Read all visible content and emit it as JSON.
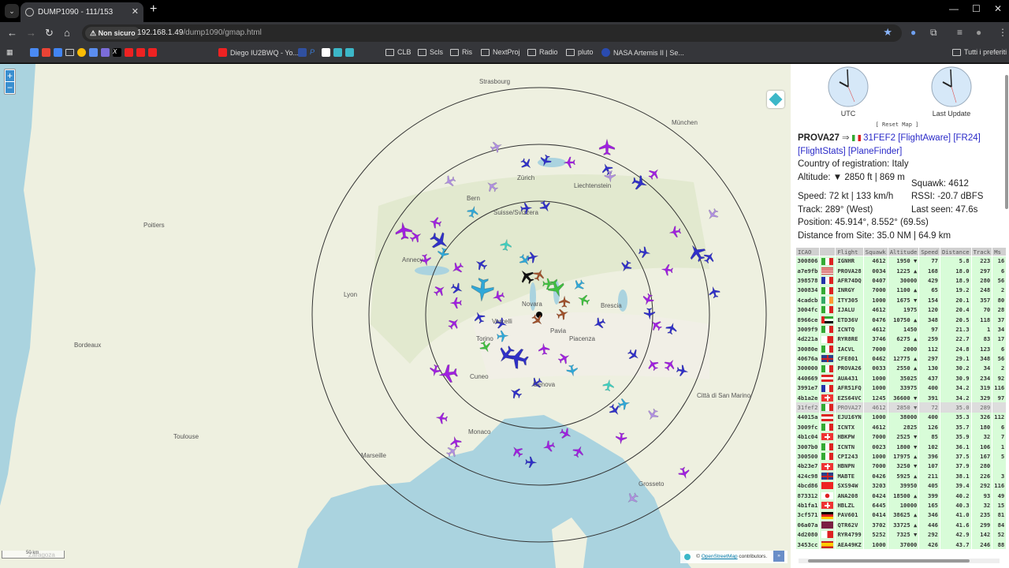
{
  "browser": {
    "tab_title": "DUMP1090 - 111/153",
    "security": "Non sicuro",
    "url_host": "192.168.1.49",
    "url_path": "/dump1090/gmap.html",
    "bookmarks": [
      "Diego IU2BWQ - Yo...",
      "CLB",
      "Scls",
      "Ris",
      "NextProj",
      "Radio",
      "pluto",
      "NASA Artemis II | Se..."
    ],
    "all_bookmarks": "Tutti i preferiti"
  },
  "map": {
    "zoom_in": "+",
    "zoom_out": "−",
    "attribution_prefix": "©",
    "attribution_link": "OpenStreetMap",
    "attribution_suffix": "contributors.",
    "scale": "50 km",
    "cities": [
      "Strasbourg",
      "München",
      "Zürich",
      "Liechtenstein",
      "Bern",
      "Suisse/Svizzera",
      "Poitiers",
      "Lyon",
      "Annecy",
      "Bordeaux",
      "Novara",
      "Vercelli",
      "Pavia",
      "Piacenza",
      "Brescia",
      "Torino",
      "Cuneo",
      "Genova",
      "Monaco",
      "Marseille",
      "Toulouse",
      "Città di San Marino",
      "Grosseto",
      "Zaragoza"
    ]
  },
  "panel": {
    "clock_utc": "UTC",
    "clock_last": "Last Update",
    "reset": "[ Reset Map ]",
    "selected": {
      "flight": "PROVA27",
      "arrow": "⇒",
      "icao": "31FEF2",
      "links": [
        "[FlightAware]",
        "[FR24]",
        "[FlightStats]",
        "[PlaneFinder]"
      ],
      "country": "Country of registration: Italy",
      "altitude": "Altitude: ▼ 2850 ft | 869 m",
      "squawk": "Squawk: 4612",
      "speed": "Speed: 72 kt | 133 km/h",
      "rssi": "RSSI: -20.7 dBFS",
      "track": "Track: 289° (West)",
      "last_seen": "Last seen: 47.6s",
      "position": "Position: 45.914°, 8.552° (69.5s)",
      "distance": "Distance from Site: 35.0 NM | 64.9 km"
    },
    "columns": [
      "ICAO",
      "",
      "Flight",
      "Squawk",
      "Altitude",
      "Speed",
      "Distance",
      "Track",
      "Ms"
    ],
    "rows": [
      [
        "300806",
        "it",
        "IGNHR",
        "4612",
        "1950 ▼",
        "77",
        "5.8",
        "223",
        "16"
      ],
      [
        "a7e9fb",
        "us",
        "PROVA28",
        "0034",
        "1225 ▲",
        "168",
        "18.0",
        "297",
        "6"
      ],
      [
        "398578",
        "fr",
        "AFR74DQ",
        "0407",
        "30000",
        "429",
        "18.9",
        "280",
        "56"
      ],
      [
        "300834",
        "it",
        "INRGY",
        "7000",
        "1100 ▲",
        "65",
        "19.2",
        "248",
        "2"
      ],
      [
        "4cadcb",
        "ie",
        "ITY305",
        "1000",
        "1675 ▼",
        "154",
        "20.1",
        "357",
        "80"
      ],
      [
        "3004fc",
        "it",
        "IJALU",
        "4612",
        "1975",
        "120",
        "20.4",
        "70",
        "28"
      ],
      [
        "8966ce",
        "ae",
        "ETD36V",
        "0476",
        "10750 ▲",
        "348",
        "20.5",
        "118",
        "37"
      ],
      [
        "3009f9",
        "it",
        "ICNTQ",
        "4612",
        "1450",
        "97",
        "21.3",
        "1",
        "34"
      ],
      [
        "4d221a",
        "mt",
        "RYR8RE",
        "3746",
        "6275 ▲",
        "259",
        "22.7",
        "83",
        "17"
      ],
      [
        "30080e",
        "it",
        "IACVL",
        "7000",
        "2000",
        "112",
        "24.8",
        "123",
        "6"
      ],
      [
        "40676a",
        "gb",
        "CFE801",
        "0462",
        "12775 ▲",
        "297",
        "29.1",
        "348",
        "56"
      ],
      [
        "300000",
        "it",
        "PROVA26",
        "0033",
        "2550 ▲",
        "130",
        "30.2",
        "34",
        "2"
      ],
      [
        "440669",
        "at",
        "AUA431",
        "1000",
        "35025",
        "437",
        "30.9",
        "234",
        "92"
      ],
      [
        "3991e7",
        "fr",
        "AFR51FQ",
        "1000",
        "33975",
        "400",
        "34.2",
        "319",
        "116"
      ],
      [
        "4b1a2e",
        "ch",
        "EZS64VC",
        "1245",
        "36600 ▼",
        "391",
        "34.2",
        "329",
        "97"
      ],
      [
        "31fef2",
        "it",
        "PROVA27",
        "4612",
        "2850 ▼",
        "72",
        "35.0",
        "289",
        ""
      ],
      [
        "44015a",
        "at",
        "EJU16YN",
        "1000",
        "38000",
        "400",
        "35.3",
        "326",
        "112"
      ],
      [
        "3009fc",
        "it",
        "ICNTX",
        "4612",
        "2825",
        "126",
        "35.7",
        "180",
        "6"
      ],
      [
        "4b1c04",
        "ch",
        "HBKPW",
        "7000",
        "2525 ▼",
        "85",
        "35.9",
        "32",
        "7"
      ],
      [
        "3007b0",
        "it",
        "ICNTN",
        "0023",
        "1800 ▼",
        "102",
        "36.1",
        "106",
        "1"
      ],
      [
        "300500",
        "it",
        "CPI243",
        "1000",
        "17975 ▲",
        "396",
        "37.5",
        "167",
        "5"
      ],
      [
        "4b23e7",
        "ch",
        "HBNPN",
        "7000",
        "3250 ▼",
        "107",
        "37.9",
        "280",
        ""
      ],
      [
        "424c98",
        "gb",
        "MABTE",
        "0426",
        "5925 ▲",
        "211",
        "38.1",
        "226",
        "3"
      ],
      [
        "4bcd86",
        "tr",
        "SXS94W",
        "3203",
        "39950",
        "405",
        "39.4",
        "292",
        "116"
      ],
      [
        "873312",
        "jp",
        "ANA208",
        "0424",
        "18500 ▲",
        "399",
        "40.2",
        "93",
        "49"
      ],
      [
        "4b1fa1",
        "ch",
        "HBLZL",
        "6445",
        "10000",
        "165",
        "40.3",
        "32",
        "15"
      ],
      [
        "3cf571",
        "de",
        "PAV601",
        "0414",
        "38625 ▲",
        "346",
        "41.0",
        "235",
        "81"
      ],
      [
        "06a07a",
        "qa",
        "QTR62V",
        "3702",
        "33725 ▲",
        "446",
        "41.6",
        "299",
        "84"
      ],
      [
        "4d2080",
        "mt",
        "RYR4799",
        "5252",
        "7325 ▼",
        "292",
        "42.9",
        "142",
        "52"
      ],
      [
        "3453cc",
        "es",
        "AEA49KZ",
        "1000",
        "37000",
        "426",
        "43.7",
        "246",
        "88"
      ]
    ],
    "selected_index": 15
  }
}
